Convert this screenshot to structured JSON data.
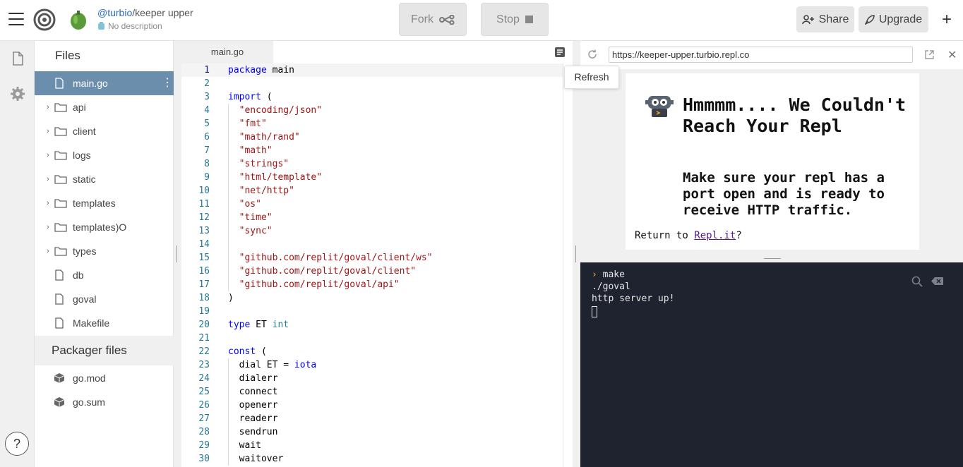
{
  "header": {
    "repl_user": "@turbio",
    "repl_separator": "/",
    "repl_name": "keeper upper",
    "repl_description": "No description",
    "fork_label": "Fork",
    "stop_label": "Stop",
    "share_label": "Share",
    "upgrade_label": "Upgrade",
    "plus_label": "+"
  },
  "rail": {
    "help_label": "?"
  },
  "files": {
    "title": "Files",
    "items": [
      {
        "name": "main.go",
        "type": "file",
        "active": true
      },
      {
        "name": "api",
        "type": "folder"
      },
      {
        "name": "client",
        "type": "folder"
      },
      {
        "name": "logs",
        "type": "folder"
      },
      {
        "name": "static",
        "type": "folder"
      },
      {
        "name": "templates",
        "type": "folder"
      },
      {
        "name": "templates)O",
        "type": "folder"
      },
      {
        "name": "types",
        "type": "folder"
      },
      {
        "name": "db",
        "type": "file"
      },
      {
        "name": "goval",
        "type": "file"
      },
      {
        "name": "Makefile",
        "type": "file"
      }
    ],
    "packager_title": "Packager files",
    "packager_items": [
      {
        "name": "go.mod"
      },
      {
        "name": "go.sum"
      }
    ]
  },
  "editor": {
    "tab_label": "main.go",
    "lines": [
      [
        {
          "t": "package",
          "c": "kw"
        },
        {
          "t": " main"
        }
      ],
      [],
      [
        {
          "t": "import",
          "c": "kw"
        },
        {
          "t": " ("
        }
      ],
      [
        {
          "t": "  "
        },
        {
          "t": "\"encoding/json\"",
          "c": "str"
        }
      ],
      [
        {
          "t": "  "
        },
        {
          "t": "\"fmt\"",
          "c": "str"
        }
      ],
      [
        {
          "t": "  "
        },
        {
          "t": "\"math/rand\"",
          "c": "str"
        }
      ],
      [
        {
          "t": "  "
        },
        {
          "t": "\"math\"",
          "c": "str"
        }
      ],
      [
        {
          "t": "  "
        },
        {
          "t": "\"strings\"",
          "c": "str"
        }
      ],
      [
        {
          "t": "  "
        },
        {
          "t": "\"html/template\"",
          "c": "str"
        }
      ],
      [
        {
          "t": "  "
        },
        {
          "t": "\"net/http\"",
          "c": "str"
        }
      ],
      [
        {
          "t": "  "
        },
        {
          "t": "\"os\"",
          "c": "str"
        }
      ],
      [
        {
          "t": "  "
        },
        {
          "t": "\"time\"",
          "c": "str"
        }
      ],
      [
        {
          "t": "  "
        },
        {
          "t": "\"sync\"",
          "c": "str"
        }
      ],
      [],
      [
        {
          "t": "  "
        },
        {
          "t": "\"github.com/replit/goval/client/ws\"",
          "c": "str"
        }
      ],
      [
        {
          "t": "  "
        },
        {
          "t": "\"github.com/replit/goval/client\"",
          "c": "str"
        }
      ],
      [
        {
          "t": "  "
        },
        {
          "t": "\"github.com/replit/goval/api\"",
          "c": "str"
        }
      ],
      [
        {
          "t": ")"
        }
      ],
      [],
      [
        {
          "t": "type",
          "c": "kw"
        },
        {
          "t": " ET "
        },
        {
          "t": "int",
          "c": "typ"
        }
      ],
      [],
      [
        {
          "t": "const",
          "c": "kw"
        },
        {
          "t": " ("
        }
      ],
      [
        {
          "t": "  dial ET = "
        },
        {
          "t": "iota",
          "c": "kw"
        }
      ],
      [
        {
          "t": "  dialerr"
        }
      ],
      [
        {
          "t": "  connect"
        }
      ],
      [
        {
          "t": "  openerr"
        }
      ],
      [
        {
          "t": "  readerr"
        }
      ],
      [
        {
          "t": "  sendrun"
        }
      ],
      [
        {
          "t": "  wait"
        }
      ],
      [
        {
          "t": "  waitover"
        }
      ]
    ]
  },
  "tooltip": {
    "refresh_label": "Refresh"
  },
  "webview": {
    "url": "https://keeper-upper.turbio.repl.co",
    "heading": "Hmmmm.... We Couldn't Reach Your Repl",
    "subheading": "Make sure your repl has a port open and is ready to receive HTTP traffic.",
    "return_prefix": "Return to ",
    "return_link": "Repl.it",
    "return_suffix": "?"
  },
  "console": {
    "lines": [
      "make",
      "./goval",
      "http server up!"
    ],
    "prompt_symbol": "›"
  },
  "colors": {
    "active_file_bg": "#6b8ead",
    "console_bg": "#1f2330",
    "prompt": "#f5a623"
  }
}
